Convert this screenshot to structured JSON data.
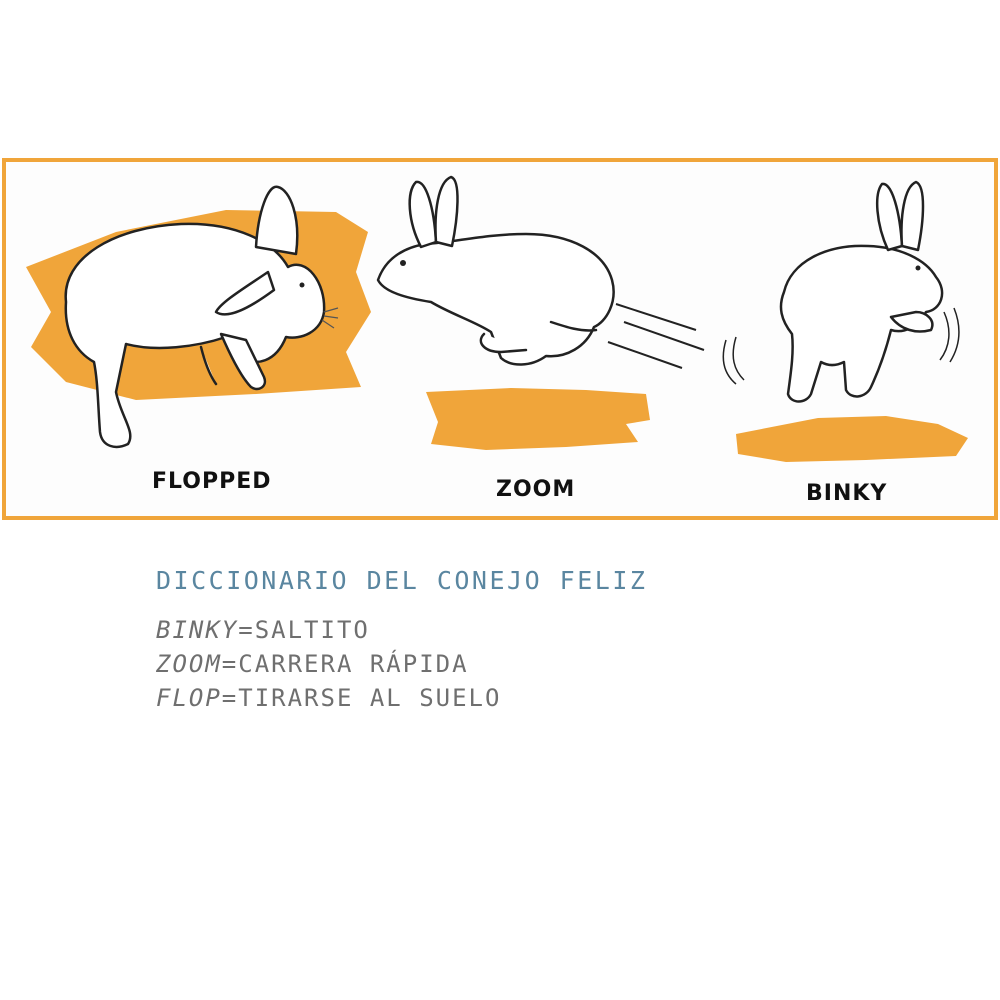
{
  "illustration": {
    "accent_color": "#f0a53a",
    "panels": [
      {
        "caption": "FLOPPED",
        "icon": "flopped-rabbit-icon"
      },
      {
        "caption": "ZOOM",
        "icon": "zooming-rabbit-icon"
      },
      {
        "caption": "BINKY",
        "icon": "binky-rabbit-icon"
      }
    ]
  },
  "dictionary": {
    "title": "DICCIONARIO DEL CONEJO FELIZ",
    "title_color": "#5a86a0",
    "entries": [
      {
        "term": "BINKY",
        "definition": "=SALTITO"
      },
      {
        "term": "ZOOM",
        "definition": "=CARRERA RÁPIDA"
      },
      {
        "term": "FLOP",
        "definition": "=TIRARSE AL SUELO"
      }
    ]
  }
}
